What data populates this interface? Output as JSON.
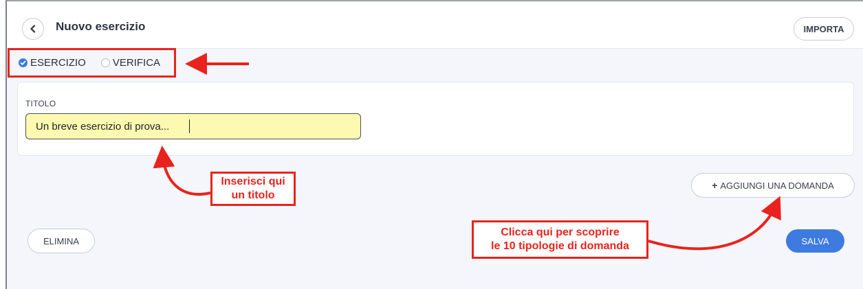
{
  "header": {
    "title": "Nuovo esercizio",
    "import_label": "IMPORTA"
  },
  "mode": {
    "options": [
      {
        "label": "ESERCIZIO",
        "selected": true
      },
      {
        "label": "VERIFICA",
        "selected": false
      }
    ]
  },
  "form": {
    "title_label": "TITOLO",
    "title_value": "Un breve esercizio di prova..."
  },
  "actions": {
    "add_question_label": "AGGIUNGI UNA DOMANDA",
    "delete_label": "ELIMINA",
    "save_label": "SALVA"
  },
  "annotations": {
    "title_hint_line1": "Inserisci qui",
    "title_hint_line2": "un titolo",
    "add_hint_line1": "Clicca qui per scoprire",
    "add_hint_line2": "le 10 tipologie di domanda"
  },
  "colors": {
    "accent": "#3d7be0",
    "annotation": "#e8231d",
    "input_highlight": "#fbfab0"
  },
  "icons": {
    "back": "chevron-left-icon",
    "selected_radio": "check-circle-icon",
    "add": "plus-icon"
  }
}
